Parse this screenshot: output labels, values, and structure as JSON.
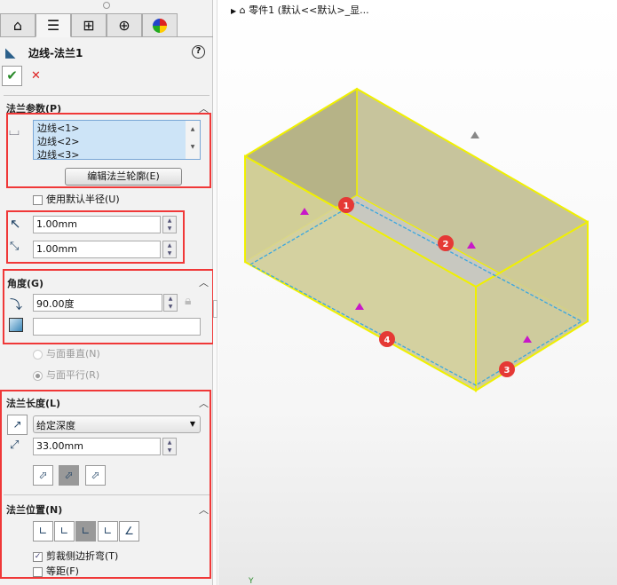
{
  "panel": {
    "tabs": [
      {
        "icon": "part-icon"
      },
      {
        "icon": "property-manager-icon"
      },
      {
        "icon": "configuration-manager-icon"
      },
      {
        "icon": "dimxpert-icon"
      },
      {
        "icon": "display-manager-icon"
      }
    ],
    "title": "边线-法兰1",
    "flange_params": {
      "header": "法兰参数(P)",
      "edges": [
        "边线<1>",
        "边线<2>",
        "边线<3>"
      ],
      "edit_profile_button": "编辑法兰轮廓(E)",
      "use_default_radius": "使用默认半径(U)",
      "use_default_radius_checked": false,
      "radius": "1.00mm",
      "gap": "1.00mm"
    },
    "angle": {
      "header": "角度(G)",
      "value": "90.00度",
      "face": "",
      "perpendicular": "与面垂直(N)",
      "parallel": "与面平行(R)",
      "selected": "parallel"
    },
    "flange_length": {
      "header": "法兰长度(L)",
      "end_condition": "给定深度",
      "length": "33.00mm"
    },
    "flange_position": {
      "header": "法兰位置(N)",
      "trim_side_bends": "剪裁侧边折弯(T)",
      "trim_side_bends_checked": true,
      "offset": "等距(F)",
      "offset_checked": false
    }
  },
  "tree": {
    "item": "零件1  (默认<<默认>_显..."
  },
  "viewport": {
    "callouts": [
      "1",
      "2",
      "3",
      "4"
    ],
    "model_color": "#d6d29a",
    "edge_color": "#f0f000",
    "axis_label": "Y"
  },
  "colors": {
    "highlight": "#f03838",
    "accent": "#2a8a2a"
  }
}
